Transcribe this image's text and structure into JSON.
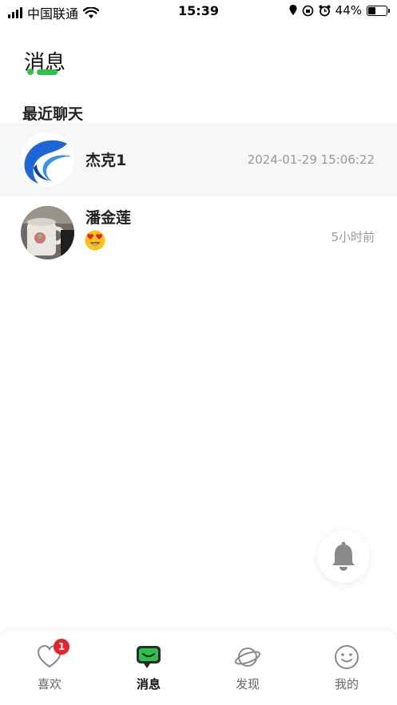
{
  "status_bar": {
    "carrier": "中国联通",
    "time": "15:39",
    "battery": "44%",
    "battery_level": 0.44
  },
  "header": {
    "title": "消息"
  },
  "section": {
    "title": "最近聊天"
  },
  "chats": [
    {
      "name": "杰克1",
      "time": "2024-01-29 15:06:22",
      "avatar": "app-logo-avatar"
    },
    {
      "name": "潘金莲",
      "time": "5小时前",
      "preview_icon": "heart-eyes-emoji-icon",
      "avatar": "mug-photo-avatar"
    }
  ],
  "tabbar": {
    "items": [
      {
        "label": "喜欢",
        "icon": "heart-icon",
        "badge": "1"
      },
      {
        "label": "消息",
        "icon": "chat-bubble-icon",
        "active": true
      },
      {
        "label": "发现",
        "icon": "planet-icon"
      },
      {
        "label": "我的",
        "icon": "smiley-icon"
      }
    ]
  },
  "colors": {
    "accent_green": "#2ec24a",
    "badge_red": "#e8212c",
    "highlight_row": "#f6f7f9"
  }
}
